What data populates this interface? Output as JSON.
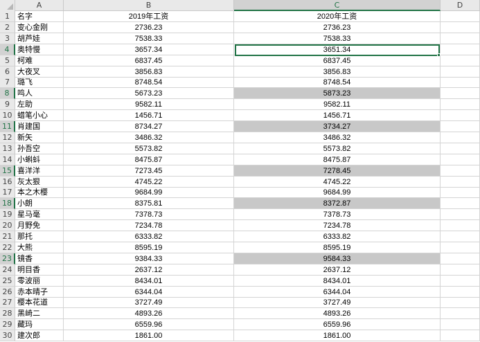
{
  "columns": [
    "A",
    "B",
    "C",
    "D"
  ],
  "header_row": {
    "name": "名字",
    "y2019": "2019年工资",
    "y2020": "2020年工资"
  },
  "rows": [
    {
      "n": "1"
    },
    {
      "n": "2",
      "name": "变心金刚",
      "y2019": "2736.23",
      "y2020": "2736.23",
      "hl": false
    },
    {
      "n": "3",
      "name": "胡芦娃",
      "y2019": "7538.33",
      "y2020": "7538.33",
      "hl": false
    },
    {
      "n": "4",
      "name": "奥特慢",
      "y2019": "3657.34",
      "y2020": "3651.34",
      "hl": false,
      "active": true
    },
    {
      "n": "5",
      "name": "柯难",
      "y2019": "6837.45",
      "y2020": "6837.45",
      "hl": false
    },
    {
      "n": "6",
      "name": "大夜叉",
      "y2019": "3856.83",
      "y2020": "3856.83",
      "hl": false
    },
    {
      "n": "7",
      "name": "璐飞",
      "y2019": "8748.54",
      "y2020": "8748.54",
      "hl": false
    },
    {
      "n": "8",
      "name": "鸣人",
      "y2019": "5673.23",
      "y2020": "5873.23",
      "hl": true
    },
    {
      "n": "9",
      "name": "左助",
      "y2019": "9582.11",
      "y2020": "9582.11",
      "hl": false
    },
    {
      "n": "10",
      "name": "蜡笔小心",
      "y2019": "1456.71",
      "y2020": "1456.71",
      "hl": false
    },
    {
      "n": "11",
      "name": "肖建国",
      "y2019": "8734.27",
      "y2020": "3734.27",
      "hl": true
    },
    {
      "n": "12",
      "name": "新矢",
      "y2019": "3486.32",
      "y2020": "3486.32",
      "hl": false
    },
    {
      "n": "13",
      "name": "孙吾空",
      "y2019": "5573.82",
      "y2020": "5573.82",
      "hl": false
    },
    {
      "n": "14",
      "name": "小蝌蚪",
      "y2019": "8475.87",
      "y2020": "8475.87",
      "hl": false
    },
    {
      "n": "15",
      "name": "喜洋洋",
      "y2019": "7273.45",
      "y2020": "7278.45",
      "hl": true
    },
    {
      "n": "16",
      "name": "灰太狠",
      "y2019": "4745.22",
      "y2020": "4745.22",
      "hl": false
    },
    {
      "n": "17",
      "name": "本之木樱",
      "y2019": "9684.99",
      "y2020": "9684.99",
      "hl": false
    },
    {
      "n": "18",
      "name": "小朗",
      "y2019": "8375.81",
      "y2020": "8372.87",
      "hl": true
    },
    {
      "n": "19",
      "name": "星马毫",
      "y2019": "7378.73",
      "y2020": "7378.73",
      "hl": false
    },
    {
      "n": "20",
      "name": "月野免",
      "y2019": "7234.78",
      "y2020": "7234.78",
      "hl": false
    },
    {
      "n": "21",
      "name": "那托",
      "y2019": "6333.82",
      "y2020": "6333.82",
      "hl": false
    },
    {
      "n": "22",
      "name": "大熊",
      "y2019": "8595.19",
      "y2020": "8595.19",
      "hl": false
    },
    {
      "n": "23",
      "name": "镜香",
      "y2019": "9384.33",
      "y2020": "9584.33",
      "hl": true
    },
    {
      "n": "24",
      "name": "明目香",
      "y2019": "2637.12",
      "y2020": "2637.12",
      "hl": false
    },
    {
      "n": "25",
      "name": "零波丽",
      "y2019": "8434.01",
      "y2020": "8434.01",
      "hl": false
    },
    {
      "n": "26",
      "name": "赤本晴子",
      "y2019": "6344.04",
      "y2020": "6344.04",
      "hl": false
    },
    {
      "n": "27",
      "name": "樱本花道",
      "y2019": "3727.49",
      "y2020": "3727.49",
      "hl": false
    },
    {
      "n": "28",
      "name": "黑崎二",
      "y2019": "4893.26",
      "y2020": "4893.26",
      "hl": false
    },
    {
      "n": "29",
      "name": "藏玛",
      "y2019": "6559.96",
      "y2020": "6559.96",
      "hl": false
    },
    {
      "n": "30",
      "name": "建次郎",
      "y2019": "1861.00",
      "y2020": "1861.00",
      "hl": false
    }
  ],
  "selected_column": "C",
  "highlighted_rows": [
    "4",
    "8",
    "11",
    "15",
    "18",
    "23"
  ],
  "colors": {
    "highlight_fill": "#c8c8c8",
    "selection_green": "#217346"
  }
}
